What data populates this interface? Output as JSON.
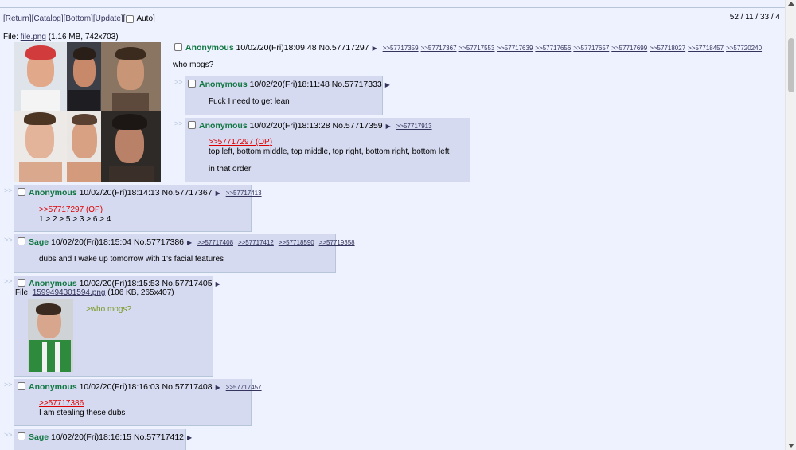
{
  "nav": {
    "return": "[Return]",
    "catalog": "[Catalog]",
    "bottom": "[Bottom]",
    "update": "[Update]",
    "auto_open": "[",
    "auto": "Auto]"
  },
  "stats": "52 / 11 / 33 / 4",
  "op": {
    "file_prefix": "File:",
    "file_name": "file.png",
    "file_meta": "(1.16 MB, 742x703)",
    "name": "Anonymous",
    "datetime": "10/02/20(Fri)18:09:48",
    "no": "No.57717297",
    "arrow": "▶",
    "backlinks": [
      ">>57717359",
      ">>57717367",
      ">>57717553",
      ">>57717639",
      ">>57717656",
      ">>57717657",
      ">>57717699",
      ">>57718027",
      ">>57718457",
      ">>57720240"
    ],
    "message": "who mogs?"
  },
  "replies": [
    {
      "id": "r1",
      "name": "Anonymous",
      "datetime": "10/02/20(Fri)18:11:48",
      "no": "No.57717333",
      "arrow": "▶",
      "backlinks": [],
      "lines": [
        "Fuck I need to get lean"
      ]
    },
    {
      "id": "r2",
      "name": "Anonymous",
      "datetime": "10/02/20(Fri)18:13:28",
      "no": "No.57717359",
      "arrow": "▶",
      "backlinks": [
        ">>57717913"
      ],
      "quote": ">>57717297 (OP)",
      "lines": [
        "top left, bottom middle, top middle, top right, bottom right, bottom left",
        "in that order"
      ]
    },
    {
      "id": "r3",
      "name": "Anonymous",
      "datetime": "10/02/20(Fri)18:14:13",
      "no": "No.57717367",
      "arrow": "▶",
      "backlinks": [
        ">>57717413"
      ],
      "quote": ">>57717297 (OP)",
      "lines": [
        "1 > 2 > 5 > 3 > 6 > 4"
      ]
    },
    {
      "id": "r4",
      "name": "Sage",
      "datetime": "10/02/20(Fri)18:15:04",
      "no": "No.57717386",
      "arrow": "▶",
      "backlinks": [
        ">>57717408",
        ">>57717412",
        ">>57718590",
        ">>57719358"
      ],
      "lines": [
        "dubs and I wake up tomorrow with 1's facial features"
      ]
    },
    {
      "id": "r5",
      "name": "Anonymous",
      "datetime": "10/02/20(Fri)18:15:53",
      "no": "No.57717405",
      "arrow": "▶",
      "file_prefix": "File:",
      "file_name": "1599494301594.png",
      "file_meta": "(106 KB, 265x407)",
      "greentext": ">who mogs?"
    },
    {
      "id": "r6",
      "name": "Anonymous",
      "datetime": "10/02/20(Fri)18:16:03",
      "no": "No.57717408",
      "arrow": "▶",
      "backlinks": [
        ">>57717457"
      ],
      "quote": ">>57717386",
      "lines": [
        "I am stealing these dubs"
      ]
    },
    {
      "id": "r7",
      "name": "Sage",
      "datetime": "10/02/20(Fri)18:16:15",
      "no": "No.57717412",
      "arrow": "▶"
    }
  ],
  "side_marker": ">>",
  "colors": {
    "bg": "#eef2ff",
    "reply_bg": "#d6daf0",
    "name": "#117743",
    "quote": "#dd0000",
    "greentext": "#789922"
  }
}
